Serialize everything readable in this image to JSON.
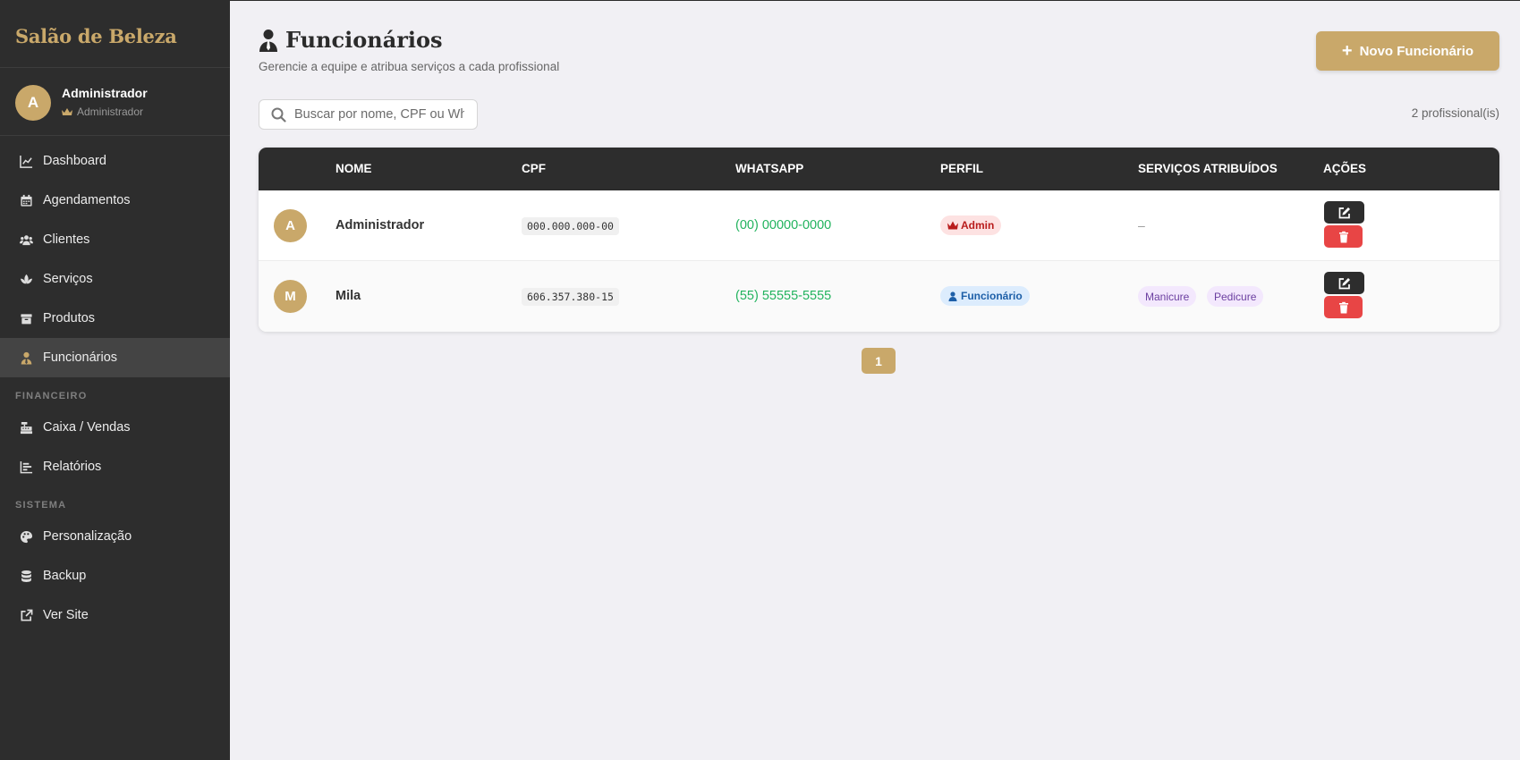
{
  "sidebar": {
    "brand": "Salão de Beleza",
    "user": {
      "initial": "A",
      "name": "Administrador",
      "role": "Administrador"
    },
    "items": [
      {
        "label": "Dashboard",
        "icon": "chart-line-icon"
      },
      {
        "label": "Agendamentos",
        "icon": "calendar-icon"
      },
      {
        "label": "Clientes",
        "icon": "users-icon"
      },
      {
        "label": "Serviços",
        "icon": "spa-icon"
      },
      {
        "label": "Produtos",
        "icon": "box-icon"
      },
      {
        "label": "Funcionários",
        "icon": "user-tie-icon",
        "active": true
      }
    ],
    "sections": [
      {
        "title": "FINANCEIRO",
        "items": [
          {
            "label": "Caixa / Vendas",
            "icon": "cash-register-icon"
          },
          {
            "label": "Relatórios",
            "icon": "bar-chart-icon"
          }
        ]
      },
      {
        "title": "SISTEMA",
        "items": [
          {
            "label": "Personalização",
            "icon": "palette-icon"
          },
          {
            "label": "Backup",
            "icon": "database-icon"
          },
          {
            "label": "Ver Site",
            "icon": "external-link-icon"
          }
        ]
      }
    ]
  },
  "header": {
    "title": "Funcionários",
    "subtitle": "Gerencie a equipe e atribua serviços a cada profissional",
    "new_button": "Novo Funcionário"
  },
  "search": {
    "placeholder": "Buscar por nome, CPF ou WhatsApp",
    "value": ""
  },
  "count_label": "2 profissional(is)",
  "table": {
    "columns": [
      "NOME",
      "CPF",
      "WHATSAPP",
      "PERFIL",
      "SERVIÇOS ATRIBUÍDOS",
      "AÇÕES"
    ],
    "rows": [
      {
        "initial": "A",
        "name": "Administrador",
        "cpf": "000.000.000-00",
        "whatsapp": "(00) 00000-0000",
        "profile": "Admin",
        "services_empty": "–",
        "services": []
      },
      {
        "initial": "M",
        "name": "Mila",
        "cpf": "606.357.380-15",
        "whatsapp": "(55) 55555-5555",
        "profile": "Funcionário",
        "services": [
          "Manicure",
          "Pedicure"
        ]
      }
    ]
  },
  "pagination": {
    "current": "1"
  },
  "colors": {
    "accent": "#c9a86a",
    "sidebar": "#2d2d2d",
    "whatsapp": "#22b35e",
    "danger": "#e84545"
  }
}
